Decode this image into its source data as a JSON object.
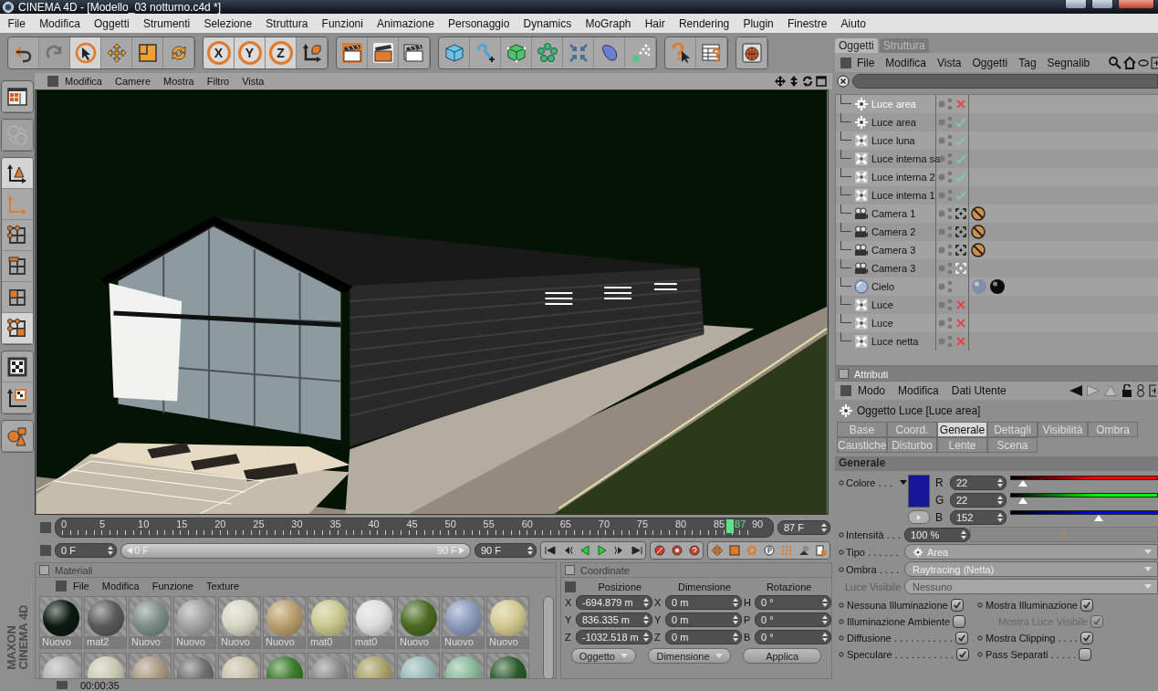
{
  "window": {
    "title": "CINEMA 4D - [Modello_03 notturno.c4d *]"
  },
  "menu_bar": [
    "File",
    "Modifica",
    "Oggetti",
    "Strumenti",
    "Selezione",
    "Struttura",
    "Funzioni",
    "Animazione",
    "Personaggio",
    "Dynamics",
    "MoGraph",
    "Hair",
    "Rendering",
    "Plugin",
    "Finestre",
    "Aiuto"
  ],
  "toolbar": [
    [
      {
        "kind": "undo",
        "selected": false,
        "disabled": false
      },
      {
        "kind": "redo",
        "selected": false,
        "disabled": true
      },
      {
        "kind": "pointer",
        "selected": true,
        "disabled": false
      },
      {
        "kind": "move",
        "selected": false,
        "disabled": false
      },
      {
        "kind": "scale",
        "selected": false,
        "disabled": false
      },
      {
        "kind": "rotate",
        "selected": false,
        "disabled": false
      }
    ],
    [
      {
        "kind": "axis",
        "label": "X",
        "selected": true,
        "disabled": false
      },
      {
        "kind": "axis",
        "label": "Y",
        "selected": true,
        "disabled": false
      },
      {
        "kind": "axis",
        "label": "Z",
        "selected": true,
        "disabled": false
      },
      {
        "kind": "coord",
        "selected": false,
        "disabled": false
      }
    ],
    [
      {
        "kind": "render-view",
        "selected": false,
        "disabled": false
      },
      {
        "kind": "render-picture",
        "selected": false,
        "disabled": false
      },
      {
        "kind": "render-settings",
        "selected": false,
        "disabled": false
      }
    ],
    [
      {
        "kind": "cube",
        "selected": false,
        "disabled": false
      },
      {
        "kind": "spline",
        "selected": false,
        "disabled": false
      },
      {
        "kind": "nurbs",
        "selected": false,
        "disabled": false
      },
      {
        "kind": "array",
        "selected": false,
        "disabled": false
      },
      {
        "kind": "deformer",
        "selected": false,
        "disabled": false
      },
      {
        "kind": "environment",
        "selected": false,
        "disabled": false
      },
      {
        "kind": "particles",
        "selected": false,
        "disabled": false
      }
    ],
    [
      {
        "kind": "help",
        "selected": false,
        "disabled": false
      },
      {
        "kind": "helptable",
        "selected": false,
        "disabled": false
      }
    ],
    [
      {
        "kind": "web",
        "selected": false,
        "disabled": false
      }
    ]
  ],
  "left_toolbar": [
    [
      {
        "kind": "layout",
        "selected": false,
        "disabled": false
      }
    ],
    [
      {
        "kind": "world",
        "selected": false,
        "disabled": true
      }
    ],
    [
      {
        "kind": "objtool",
        "selected": true,
        "disabled": false
      },
      {
        "kind": "axistool",
        "selected": false,
        "disabled": false
      },
      {
        "kind": "points",
        "selected": false,
        "disabled": false
      },
      {
        "kind": "edges",
        "selected": false,
        "disabled": false
      },
      {
        "kind": "polys",
        "selected": false,
        "disabled": false
      },
      {
        "kind": "multi",
        "selected": true,
        "disabled": false
      }
    ],
    [
      {
        "kind": "texture",
        "selected": false,
        "disabled": false
      },
      {
        "kind": "textureaxis",
        "selected": false,
        "disabled": false
      }
    ],
    [
      {
        "kind": "shapes",
        "selected": false,
        "disabled": false
      }
    ]
  ],
  "logo": {
    "brand": "MAXON",
    "product": "CINEMA 4D"
  },
  "viewport": {
    "menu": [
      "Modifica",
      "Camere",
      "Mostra",
      "Filtro",
      "Vista"
    ]
  },
  "timeline": {
    "ticks": [
      "0",
      "5",
      "10",
      "15",
      "20",
      "25",
      "30",
      "35",
      "40",
      "45",
      "50",
      "55",
      "60",
      "65",
      "70",
      "75",
      "80",
      "85",
      "90"
    ],
    "playhead": {
      "label": "87",
      "level": 0.967
    },
    "current_frame": "87 F",
    "start_frame": "0 F",
    "range": {
      "start": "0 F",
      "end": "90 F",
      "level": 1
    },
    "end_frame": "90 F"
  },
  "materials": {
    "title": "Materiali",
    "checked": false,
    "menu": [
      "File",
      "Modifica",
      "Funzione",
      "Texture"
    ],
    "rows": [
      [
        {
          "name": "Nuovo",
          "color": "#0c1a10"
        },
        {
          "name": "mat2",
          "color": "#5a5a5a"
        },
        {
          "name": "Nuovo",
          "color": "#7d8d86"
        },
        {
          "name": "Nuovo",
          "color": "#a2a2a2"
        },
        {
          "name": "Nuovo",
          "color": "#d6d6c4"
        },
        {
          "name": "Nuovo",
          "color": "#b89e6c"
        },
        {
          "name": "mat0",
          "color": "#c8c88e"
        },
        {
          "name": "mat0",
          "color": "#dcdcdc"
        },
        {
          "name": "Nuovo",
          "color": "#4a6a22"
        },
        {
          "name": "Nuovo",
          "color": "#8a9abc"
        },
        {
          "name": "Nuovo",
          "color": "#d2c890"
        }
      ],
      [
        {
          "color": "#b0b0b0"
        },
        {
          "color": "#c8c8b0"
        },
        {
          "color": "#a89880"
        },
        {
          "color": "#707070"
        },
        {
          "color": "#c8c0a8"
        },
        {
          "color": "#3a7a2a"
        },
        {
          "color": "#8a8a8a"
        },
        {
          "color": "#a8a068"
        },
        {
          "color": "#98b8b8"
        },
        {
          "color": "#88b898"
        },
        {
          "color": "#2a5a2a"
        }
      ]
    ]
  },
  "coordinates": {
    "title": "Coordinate",
    "checked": false,
    "headers": [
      "Posizione",
      "Dimensione",
      "Rotazione"
    ],
    "rows": [
      {
        "position_axis": "X",
        "position": "-694.879 m",
        "size_axis": "X",
        "size": "0 m",
        "rotation_axis": "H",
        "rotation": "0 °"
      },
      {
        "position_axis": "Y",
        "position": "836.335 m",
        "size_axis": "Y",
        "size": "0 m",
        "rotation_axis": "P",
        "rotation": "0 °"
      },
      {
        "position_axis": "Z",
        "position": "-1032.518 m",
        "size_axis": "Z",
        "size": "0 m",
        "rotation_axis": "B",
        "rotation": "0 °"
      }
    ],
    "mode": "Oggetto",
    "size_mode": "Dimensione",
    "apply": "Applica"
  },
  "status_bar": {
    "time": "00:00:35"
  },
  "objects": {
    "tabs": [
      {
        "label": "Oggetti",
        "selected": true
      },
      {
        "label": "Struttura",
        "selected": false
      }
    ],
    "menu": [
      "File",
      "Modifica",
      "Vista",
      "Oggetti",
      "Tag",
      "Segnalib"
    ],
    "items": [
      {
        "name": "Luce area",
        "kind": "area-light",
        "selected": true,
        "enabled": false
      },
      {
        "name": "Luce area",
        "kind": "area-light",
        "selected": false,
        "enabled": true
      },
      {
        "name": "Luce  luna",
        "kind": "light",
        "selected": false,
        "enabled": true
      },
      {
        "name": "Luce interna sa",
        "kind": "light",
        "selected": false,
        "enabled": true
      },
      {
        "name": "Luce interna 2",
        "kind": "light",
        "selected": false,
        "enabled": true
      },
      {
        "name": "Luce interna 1",
        "kind": "light",
        "selected": false,
        "enabled": true
      },
      {
        "name": "Camera 1",
        "kind": "camera",
        "selected": false,
        "active": false,
        "tags": [
          {
            "kind": "protection"
          }
        ]
      },
      {
        "name": "Camera 2",
        "kind": "camera",
        "selected": false,
        "active": false,
        "tags": [
          {
            "kind": "protection"
          }
        ]
      },
      {
        "name": "Camera 3",
        "kind": "camera",
        "selected": false,
        "active": false,
        "tags": [
          {
            "kind": "protection"
          }
        ]
      },
      {
        "name": "Camera 3",
        "kind": "camera",
        "selected": false,
        "active": true
      },
      {
        "name": "Cielo",
        "kind": "sky",
        "selected": false,
        "tags": [
          {
            "kind": "material",
            "color": "#8090a8"
          },
          {
            "kind": "material",
            "color": "#0a0a0a"
          }
        ]
      },
      {
        "name": "Luce",
        "kind": "light",
        "selected": false,
        "enabled": false
      },
      {
        "name": "Luce",
        "kind": "light",
        "selected": false,
        "enabled": false
      },
      {
        "name": "Luce netta",
        "kind": "light",
        "selected": false,
        "enabled": false
      }
    ]
  },
  "attributes": {
    "title": "Attributi",
    "checked": false,
    "menu": [
      "Modo",
      "Modifica",
      "Dati Utente"
    ],
    "object": "Oggetto Luce [Luce area]",
    "tabs": [
      [
        {
          "label": "Base",
          "selected": false
        },
        {
          "label": "Coord.",
          "selected": false
        },
        {
          "label": "Generale",
          "selected": true
        },
        {
          "label": "Dettagli",
          "selected": false
        },
        {
          "label": "Visibilità",
          "selected": false
        },
        {
          "label": "Ombra",
          "selected": false
        }
      ],
      [
        {
          "label": "Caustiche",
          "selected": false
        },
        {
          "label": "Disturbo",
          "selected": false
        },
        {
          "label": "Lente",
          "selected": false
        },
        {
          "label": "Scena",
          "selected": false
        }
      ]
    ],
    "section": "Generale",
    "color": {
      "label": "Colore . . .",
      "color": "#161698",
      "channels": [
        {
          "label": "R",
          "value": "22",
          "level": 0.086,
          "color": "#ff0000"
        },
        {
          "label": "G",
          "value": "22",
          "level": 0.086,
          "color": "#00ff00"
        },
        {
          "label": "B",
          "value": "152",
          "level": 0.596,
          "color": "#0000ff"
        }
      ]
    },
    "properties": [
      {
        "label": "Intensità . . .",
        "value": "100 %",
        "kind": "slider",
        "level": 0.5,
        "disabled": false
      },
      {
        "label": "Tipo . . . . . .",
        "value": "Area",
        "kind": "light-type-dropdown",
        "disabled": false
      },
      {
        "label": "Ombra . . . .",
        "value": "Raytracing (Netta)",
        "kind": "dropdown",
        "disabled": false
      },
      {
        "label": "Luce Visibile",
        "value": "Nessuno",
        "kind": "dropdown",
        "disabled": true
      }
    ],
    "options": [
      [
        {
          "label": "Nessuna Illuminazione",
          "checked": true,
          "disabled": false
        },
        {
          "label": "Illuminazione Ambiente",
          "checked": false,
          "disabled": false
        },
        {
          "label": "Diffusione . . . . . . . . . . .",
          "checked": true,
          "disabled": false
        },
        {
          "label": "Speculare . . . . . . . . . . .",
          "checked": true,
          "disabled": false
        }
      ],
      [
        {
          "label": "Mostra Illuminazione",
          "checked": true,
          "disabled": false
        },
        {
          "label": "Mostra Luce Visibile",
          "checked": true,
          "disabled": true
        },
        {
          "label": "Mostra Clipping . . . .",
          "checked": true,
          "disabled": false
        },
        {
          "label": "Pass Separati . . . . .",
          "checked": false,
          "disabled": false
        }
      ]
    ]
  }
}
